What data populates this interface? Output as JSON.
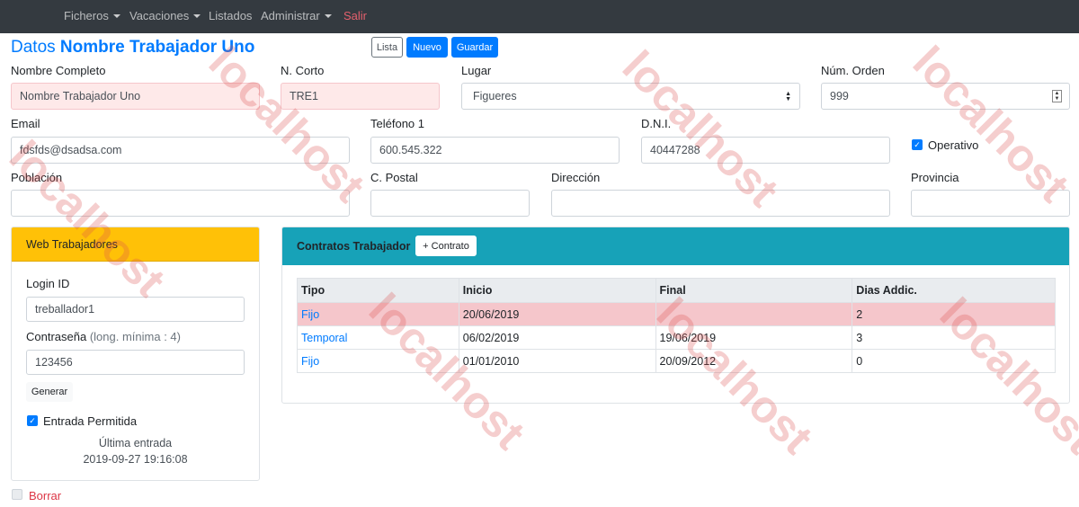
{
  "nav": {
    "items": [
      {
        "label": "Ficheros",
        "dropdown": true
      },
      {
        "label": "Vacaciones",
        "dropdown": true
      },
      {
        "label": "Listados",
        "dropdown": false
      },
      {
        "label": "Administrar",
        "dropdown": true
      }
    ],
    "salir": "Salir"
  },
  "watermark": "localhost",
  "header": {
    "title_prefix": "Datos",
    "title_name": "Nombre Trabajador Uno",
    "btn_lista": "Lista",
    "btn_nuevo": "Nuevo",
    "btn_guardar": "Guardar"
  },
  "form": {
    "nombre_label": "Nombre Completo",
    "nombre_value": "Nombre Trabajador Uno",
    "ncorto_label": "N. Corto",
    "ncorto_value": "TRE1",
    "lugar_label": "Lugar",
    "lugar_value": "Figueres",
    "orden_label": "Núm. Orden",
    "orden_value": "999",
    "email_label": "Email",
    "email_value": "fdsfds@dsadsa.com",
    "telefono_label": "Teléfono 1",
    "telefono_value": "600.545.322",
    "dni_label": "D.N.I.",
    "dni_value": "40447288",
    "operativo_label": "Operativo",
    "poblacion_label": "Población",
    "poblacion_value": "",
    "cpostal_label": "C. Postal",
    "cpostal_value": "",
    "direccion_label": "Dirección",
    "direccion_value": "",
    "provincia_label": "Provincia",
    "provincia_value": ""
  },
  "web": {
    "header": "Web Trabajadores",
    "login_label": "Login ID",
    "login_value": "treballador1",
    "pass_label": "Contraseña",
    "pass_hint": "(long. mínima : 4)",
    "pass_value": "123456",
    "generar": "Generar",
    "entrada_label": "Entrada Permitida",
    "ultima_label": "Última entrada",
    "ultima_value": "2019-09-27 19:16:08"
  },
  "contratos": {
    "header": "Contratos Trabajador",
    "add_button": "+ Contrato",
    "columns": [
      "Tipo",
      "Inicio",
      "Final",
      "Dias Addic."
    ],
    "rows": [
      {
        "tipo": "Fijo",
        "inicio": "20/06/2019",
        "final": "",
        "dias": "2",
        "highlight": true
      },
      {
        "tipo": "Temporal",
        "inicio": "06/02/2019",
        "final": "19/06/2019",
        "dias": "3",
        "highlight": false
      },
      {
        "tipo": "Fijo",
        "inicio": "01/01/2010",
        "final": "20/09/2012",
        "dias": "0",
        "highlight": false
      }
    ]
  },
  "borrar": "Borrar",
  "colors": {
    "navbar": "#343a40",
    "primary": "#007bff",
    "warning": "#ffc107",
    "info": "#17a2b8",
    "danger": "#dc3545"
  }
}
